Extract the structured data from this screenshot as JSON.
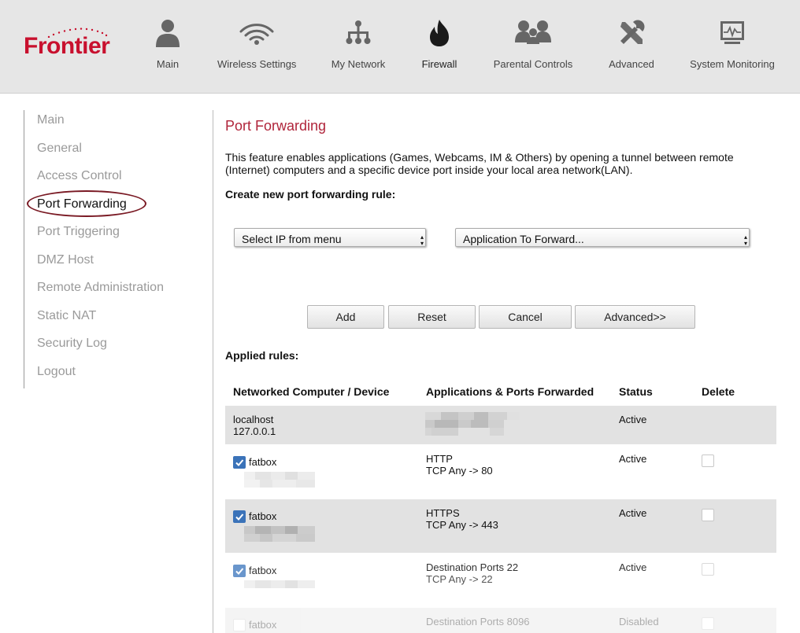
{
  "brand": {
    "name": "Frontier",
    "color": "#c8102e"
  },
  "top_nav": [
    {
      "label": "Main",
      "icon": "person-icon"
    },
    {
      "label": "Wireless Settings",
      "icon": "wifi-icon"
    },
    {
      "label": "My Network",
      "icon": "network-tree-icon"
    },
    {
      "label": "Firewall",
      "icon": "flame-icon",
      "active": true
    },
    {
      "label": "Parental Controls",
      "icon": "family-icon"
    },
    {
      "label": "Advanced",
      "icon": "tools-icon"
    },
    {
      "label": "System Monitoring",
      "icon": "monitor-icon"
    }
  ],
  "sidebar": {
    "items": [
      {
        "label": "Main"
      },
      {
        "label": "General"
      },
      {
        "label": "Access Control"
      },
      {
        "label": "Port Forwarding",
        "active": true
      },
      {
        "label": "Port Triggering"
      },
      {
        "label": "DMZ Host"
      },
      {
        "label": "Remote Administration"
      },
      {
        "label": "Static NAT"
      },
      {
        "label": "Security Log"
      },
      {
        "label": "Logout"
      }
    ]
  },
  "main": {
    "title": "Port Forwarding",
    "description": "This feature enables applications (Games, Webcams, IM & Others) by opening a tunnel between remote (Internet) computers and a specific device port inside your local area network(LAN).",
    "create_label": "Create new port forwarding rule:",
    "ip_select": "Select IP from menu",
    "app_select": "Application To Forward...",
    "buttons": {
      "add": "Add",
      "reset": "Reset",
      "cancel": "Cancel",
      "advanced": "Advanced>>"
    },
    "applied_label": "Applied rules:"
  },
  "table": {
    "headers": {
      "device": "Networked Computer / Device",
      "apps": "Applications & Ports Forwarded",
      "status": "Status",
      "delete": "Delete"
    },
    "rows": [
      {
        "device": "localhost",
        "ip": "127.0.0.1",
        "app": "",
        "ports": "",
        "status": "Active"
      },
      {
        "device": "fatbox",
        "app": "HTTP",
        "ports": "TCP Any -> 80",
        "status": "Active"
      },
      {
        "device": "fatbox",
        "app": "HTTPS",
        "ports": "TCP Any -> 443",
        "status": "Active"
      },
      {
        "device": "fatbox",
        "app": "Destination Ports 22",
        "ports": "TCP Any -> 22",
        "status": "Active"
      },
      {
        "device": "fatbox",
        "app": "Destination Ports 8096",
        "status": "Disabled"
      }
    ]
  },
  "colors": {
    "accent": "#b0253b",
    "checkbox": "#3b73b9",
    "header_bg": "#e6e6e6",
    "row_shade": "#e2e2e2"
  }
}
